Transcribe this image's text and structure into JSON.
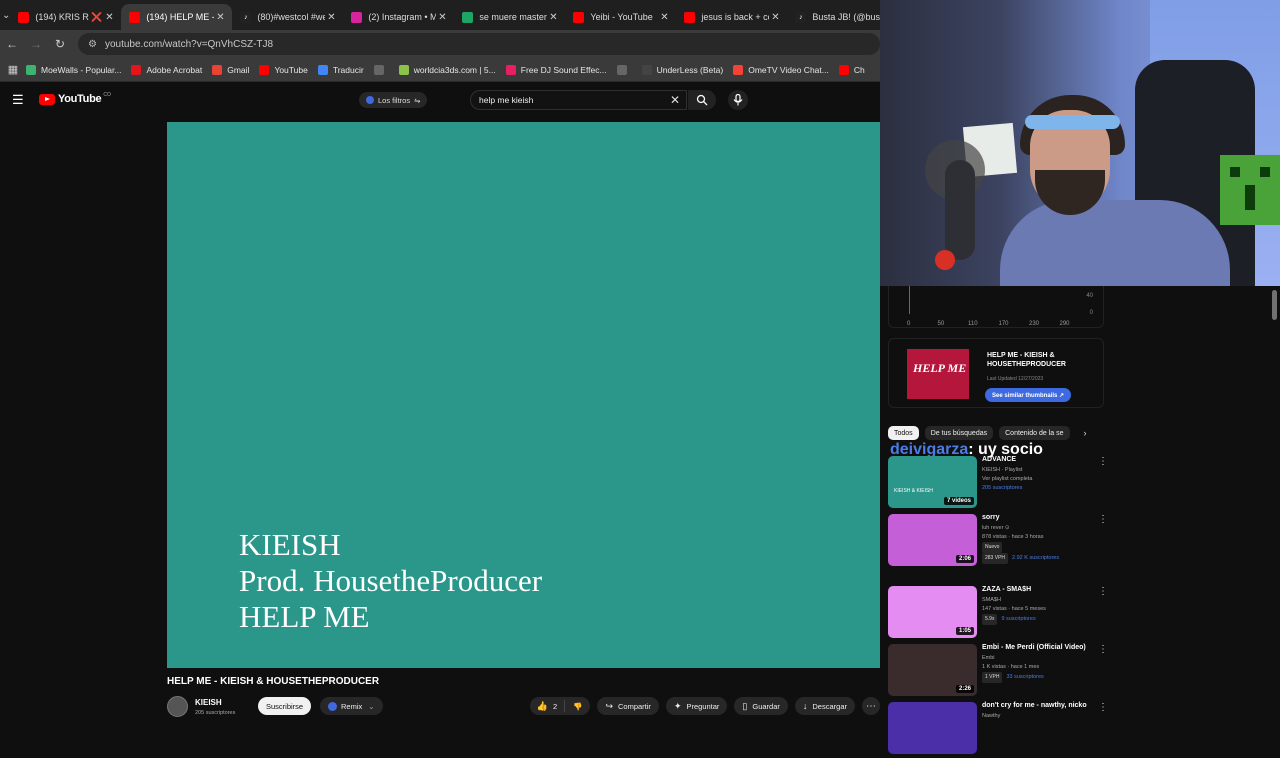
{
  "tabs": [
    {
      "label": "(194) KRIS R ❌ H",
      "icon": "youtube-icon",
      "color": "#ff0000",
      "active": false
    },
    {
      "label": "(194) HELP ME - K",
      "icon": "youtube-icon",
      "color": "#ff0000",
      "active": true
    },
    {
      "label": "(80)#westcol #we",
      "icon": "tiktok-icon",
      "color": "#222222",
      "active": false
    },
    {
      "label": "(2) Instagram • M",
      "icon": "instagram-icon",
      "color": "#d6249f",
      "active": false
    },
    {
      "label": "se muere master",
      "icon": "drive-icon",
      "color": "#1fa463",
      "active": false
    },
    {
      "label": "Yeibi - YouTube",
      "icon": "youtube-icon",
      "color": "#ff0000",
      "active": false
    },
    {
      "label": "jesus is back + cc",
      "icon": "youtube-icon",
      "color": "#ff0000",
      "active": false
    },
    {
      "label": "Busta JB! (@bus",
      "icon": "tiktok-icon",
      "color": "#222222",
      "active": false
    }
  ],
  "address": {
    "url": "youtube.com/watch?v=QnVhCSZ-TJ8"
  },
  "bookmarks": [
    {
      "label": "MoeWalls - Popular...",
      "color": "#3cb371"
    },
    {
      "label": "Adobe Acrobat",
      "color": "#e3161b"
    },
    {
      "label": "Gmail",
      "color": "#ea4335"
    },
    {
      "label": "YouTube",
      "color": "#ff0000"
    },
    {
      "label": "Traducir",
      "color": "#4285f4"
    },
    {
      "label": "",
      "color": "#666666"
    },
    {
      "label": "worldcia3ds.com | 5...",
      "color": "#8bc34a"
    },
    {
      "label": "Free DJ Sound Effec...",
      "color": "#e91e63"
    },
    {
      "label": "",
      "color": "#666666"
    },
    {
      "label": "UnderLess (Beta)",
      "color": "#444444"
    },
    {
      "label": "OmeTV Video Chat...",
      "color": "#f44336"
    },
    {
      "label": "Ch",
      "color": "#ff0000"
    }
  ],
  "youtube": {
    "logo": "YouTube",
    "country": "CO",
    "filters_label": "Los filtros",
    "search_value": "help me kieish"
  },
  "video": {
    "overlay_lines": [
      "KIEISH",
      "Prod. HousetheProducer",
      "HELP ME"
    ],
    "title": "HELP ME - KIEISH & HOUSETHEPRODUCER",
    "bg_color": "#2a978a",
    "channel": "KIEISH",
    "subscribers": "205 suscriptores",
    "subscribe_label": "Suscribirse",
    "remix_label": "Remix",
    "likes": "2",
    "share_label": "Compartir",
    "ask_label": "Preguntar",
    "save_label": "Guardar",
    "download_label": "Descargar"
  },
  "graph": {
    "values": [
      "40",
      "0"
    ],
    "xticks": [
      "0",
      "50",
      "110",
      "170",
      "230",
      "290"
    ]
  },
  "similar": {
    "thumb_text": "HELP ME",
    "title": "HELP ME - KIEISH & HOUSETHEPRODUCER",
    "updated": "Last Updated 12/27/2023",
    "button": "See similar thumbnails ↗"
  },
  "chips": [
    "Todos",
    "De tus búsquedas",
    "Contenido de la se"
  ],
  "chat": {
    "user": "deivigarza",
    "message": ": uy socio"
  },
  "related": [
    {
      "title": "ADVANCE",
      "meta1": "KIEISH · Playlist",
      "meta2": "Ver playlist completa",
      "meta3": "205 suscriptores",
      "duration": "7 videos",
      "thumb": "#2a978a",
      "thumb_text": "KIEISH & KIEISH"
    },
    {
      "title": "sorry",
      "meta1": "luh rever ⊙",
      "meta2": "878 vistas · hace 3 horas",
      "meta3": "Nuevo",
      "vph": "283 VPH",
      "subs": "2.92 K suscriptores",
      "duration": "2:06",
      "thumb": "#c45fd8"
    },
    {
      "title": "ZAZA - SMA$H",
      "meta1": "SMA$H",
      "meta2": "147 vistas · hace 5 meses",
      "vph": "5.9x",
      "subs": "9 suscriptores",
      "duration": "1:05",
      "thumb": "#e48cf2"
    },
    {
      "title": "Embi - Me Perdi (Official Video)",
      "meta1": "Embi",
      "meta2": "1 K vistas · hace 1 mes",
      "vph": "1 VPH",
      "subs": "33 suscriptores",
      "duration": "2:26",
      "thumb": "#3a2b2c"
    },
    {
      "title": "don't cry for me - nawthy, nicko",
      "meta1": "Nawthy",
      "duration": "",
      "thumb": "#4a2fa8"
    }
  ]
}
